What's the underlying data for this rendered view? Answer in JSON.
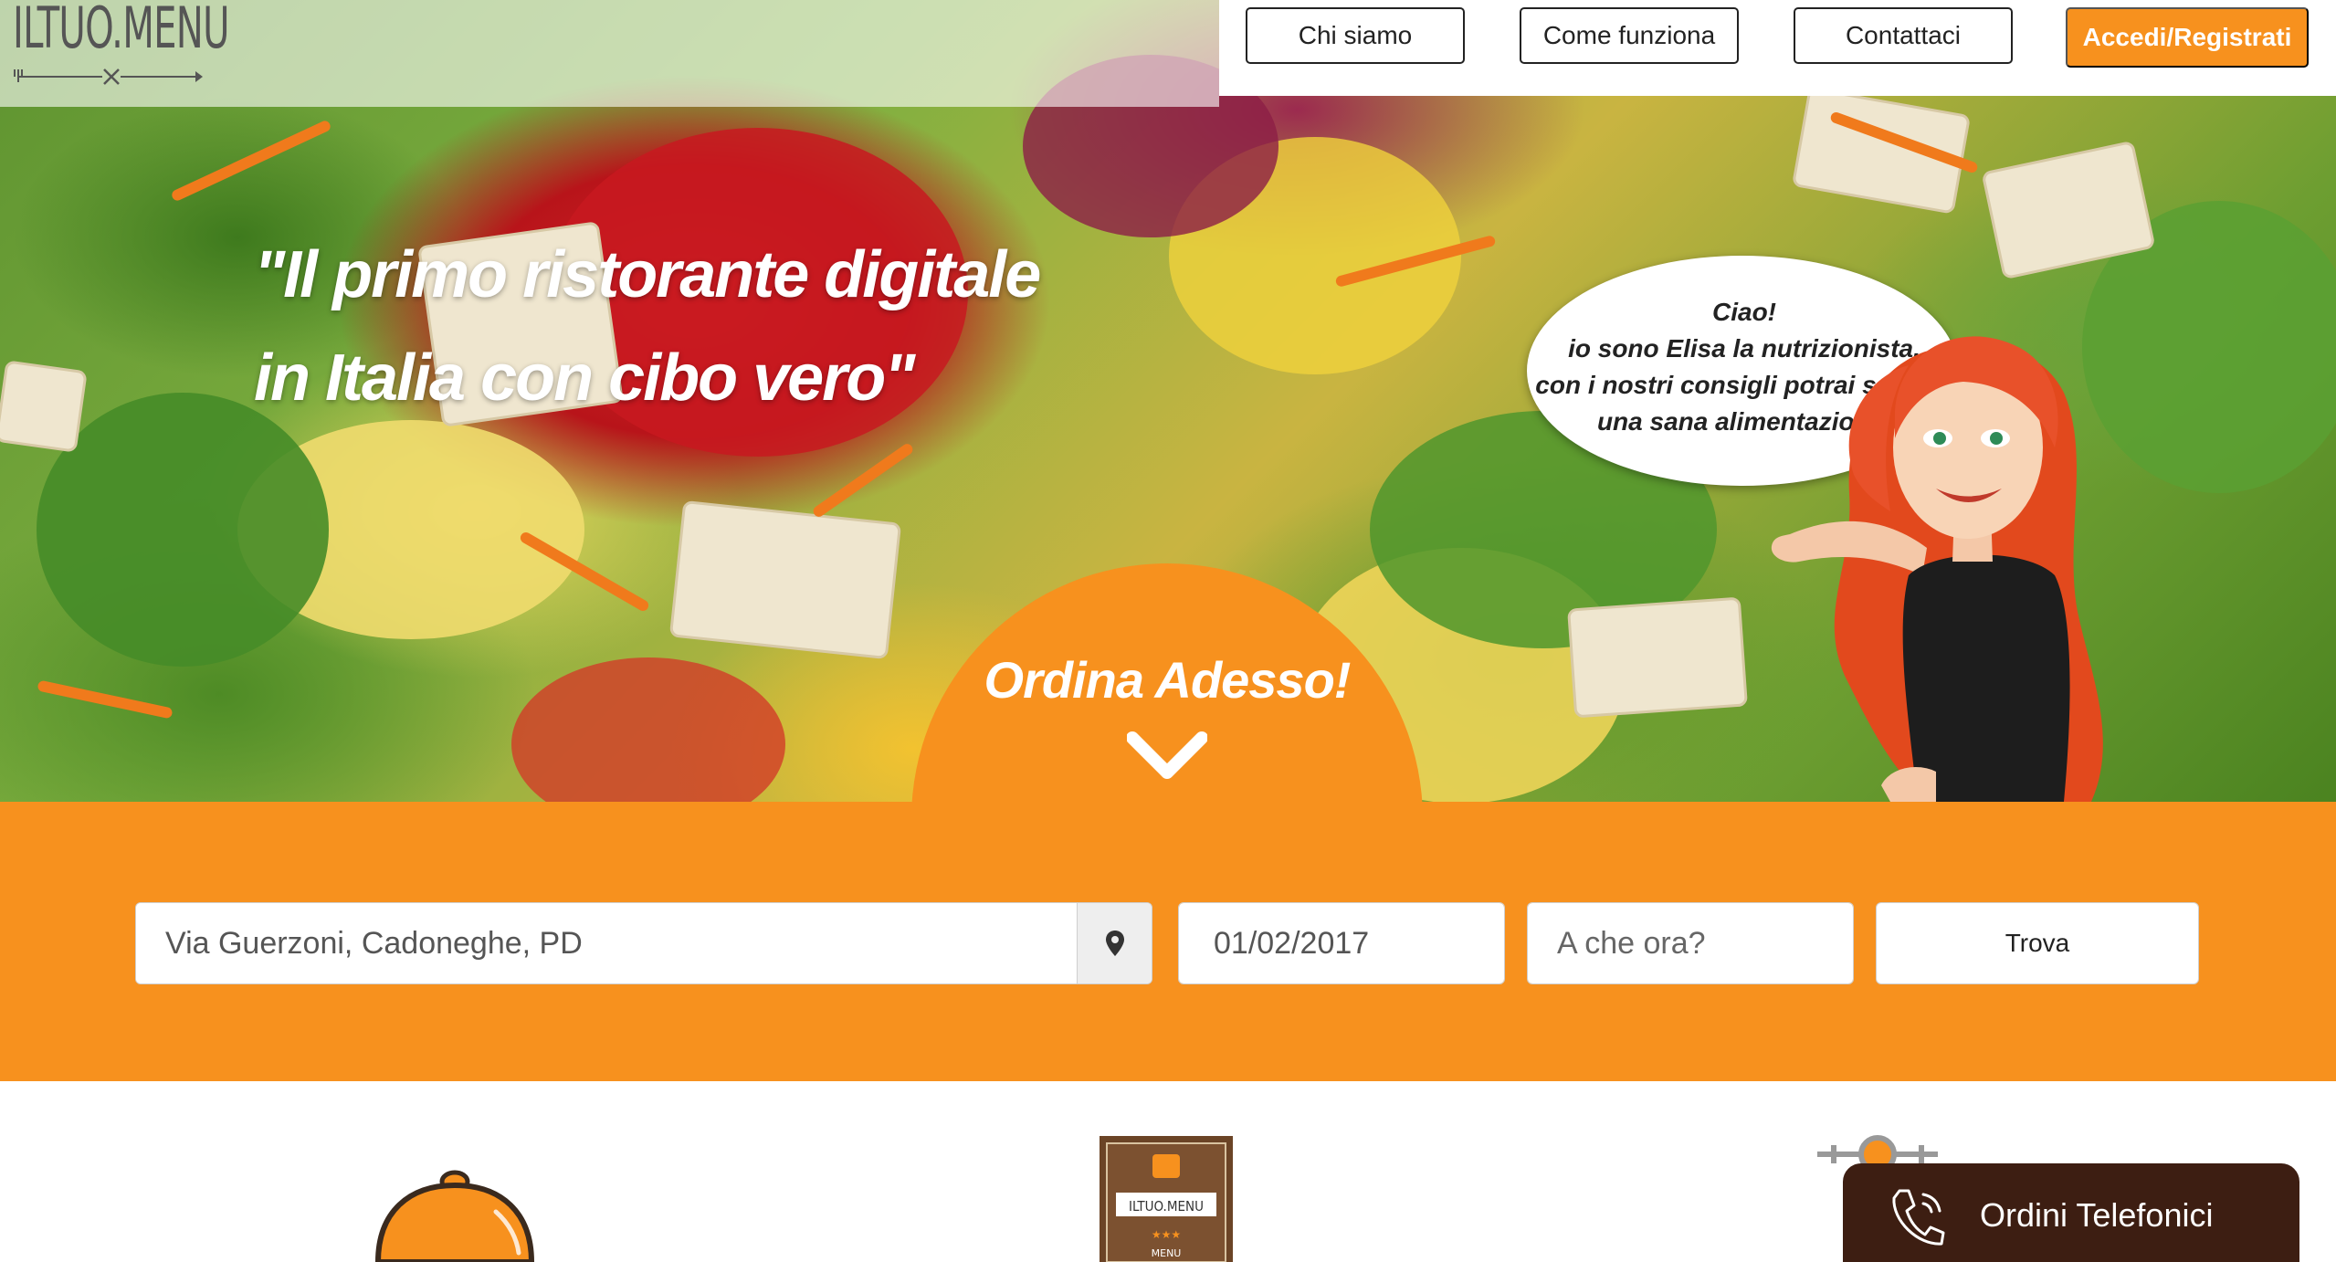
{
  "brand": {
    "logo_text": "ILTUO.MENU"
  },
  "nav": {
    "about": "Chi siamo",
    "how_it_works": "Come funziona",
    "contact": "Contattaci",
    "login": "Accedi/Registrati"
  },
  "hero": {
    "headline_line1": "\"Il primo ristorante digitale",
    "headline_line2": "in Italia con cibo vero\"",
    "bubble_line1": "Ciao!",
    "bubble_line2": "io sono Elisa la nutrizionista,",
    "bubble_line3": "con i nostri consigli potrai seguire",
    "bubble_line4": "una sana alimentazione.",
    "order_cta": "Ordina Adesso!"
  },
  "search": {
    "address_value": "Via Guerzoni, Cadoneghe, PD",
    "date_value": "01/02/2017",
    "time_placeholder": "A che ora?",
    "submit_label": "Trova"
  },
  "phone_orders": {
    "label": "Ordini Telefonici"
  },
  "colors": {
    "accent": "#f7911e",
    "dark_brown": "#3d1e12"
  },
  "icons": {
    "address": "map-marker-icon",
    "date": "calendar-icon",
    "time": "clock-icon",
    "cta": "chevron-down-icon",
    "phone": "phone-icon"
  }
}
